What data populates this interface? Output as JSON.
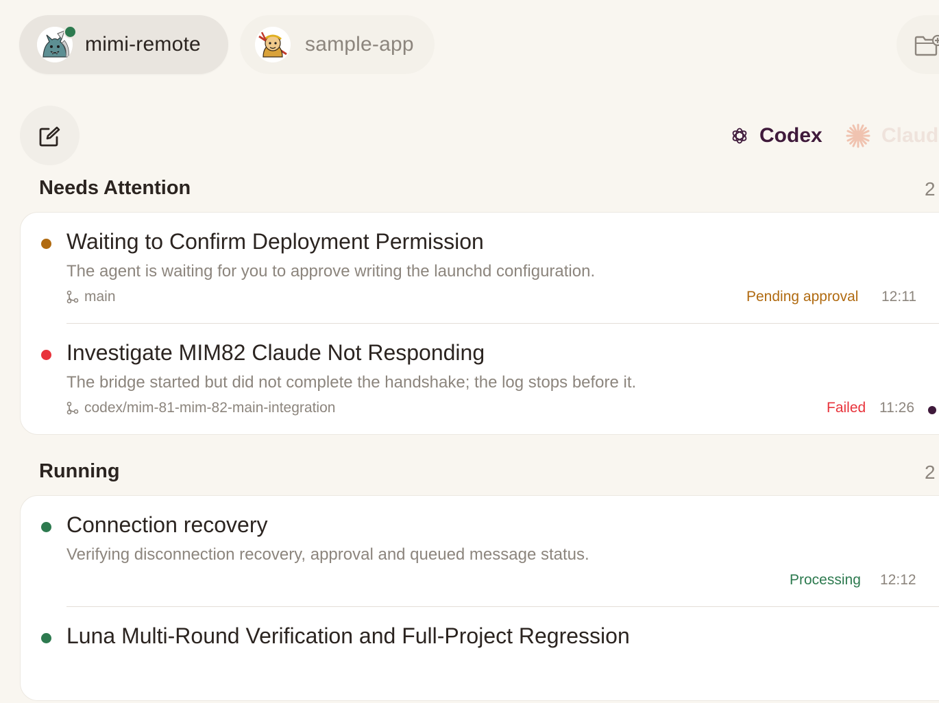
{
  "projects": [
    {
      "name": "mimi-remote",
      "active": true,
      "online": true
    },
    {
      "name": "sample-app",
      "active": false
    }
  ],
  "agents": [
    {
      "label": "Codex",
      "selected": true
    },
    {
      "label": "Claude",
      "selected": false
    }
  ],
  "sections": [
    {
      "title": "Needs Attention",
      "count": "2",
      "tasks": [
        {
          "title": "Waiting to Confirm Deployment Permission",
          "description": "The agent is waiting for you to approve writing the launchd configuration.",
          "branch": "main",
          "status": "Pending approval",
          "time": "12:11",
          "dot_color": "#b06a10",
          "status_color": "#b06a10"
        },
        {
          "title": "Investigate MIM82 Claude Not Responding",
          "description": "The bridge started but did not complete the handshake; the log stops before it.",
          "branch": "codex/mim-81-mim-82-main-integration",
          "status": "Failed",
          "time": "11:26",
          "dot_color": "#e8333b",
          "status_color": "#e8333b",
          "unread": true
        }
      ]
    },
    {
      "title": "Running",
      "count": "2",
      "tasks": [
        {
          "title": "Connection recovery",
          "description": "Verifying disconnection recovery, approval and queued message status.",
          "status": "Processing",
          "time": "12:12",
          "dot_color": "#2d7a4f",
          "status_color": "#2d7a4f"
        },
        {
          "title": "Luna Multi-Round Verification and Full-Project Regression",
          "dot_color": "#2d7a4f"
        }
      ]
    }
  ],
  "colors": {
    "background": "#f9f6f0",
    "card": "#ffffff",
    "codex_accent": "#3f1a3b",
    "claude_accent": "#e9a78c"
  }
}
